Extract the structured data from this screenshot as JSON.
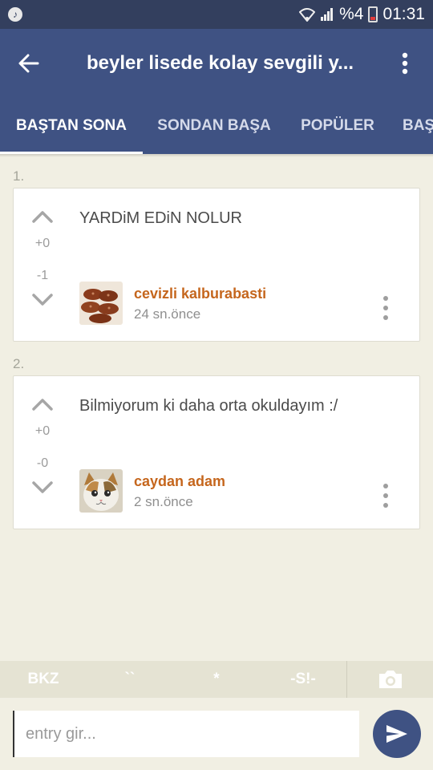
{
  "status_bar": {
    "battery_text": "%4",
    "time": "01:31"
  },
  "app_bar": {
    "title": "beyler lisede kolay sevgili y..."
  },
  "tabs": [
    {
      "label": "BAŞTAN SONA"
    },
    {
      "label": "SONDAN BAŞA"
    },
    {
      "label": "POPÜLER"
    },
    {
      "label": "BAŞ"
    }
  ],
  "entries": [
    {
      "number": "1.",
      "text": "YARDiM EDiN NOLUR",
      "up_count": "+0",
      "down_count": "-1",
      "author": "cevizli kalburabasti",
      "time": "24 sn.önce"
    },
    {
      "number": "2.",
      "text": "Bilmiyorum ki daha orta okuldayım :/",
      "up_count": "+0",
      "down_count": "-0",
      "author": "caydan adam",
      "time": "2 sn.önce"
    }
  ],
  "format_bar": {
    "bkz": "BKZ",
    "backticks": "``",
    "asterisk": "*",
    "spoiler": "-S!-"
  },
  "composer": {
    "placeholder": "entry gir..."
  },
  "colors": {
    "status_bar": "#333f5e",
    "app_bar": "#3f5283",
    "background": "#f1efe3",
    "author": "#c5661d"
  }
}
